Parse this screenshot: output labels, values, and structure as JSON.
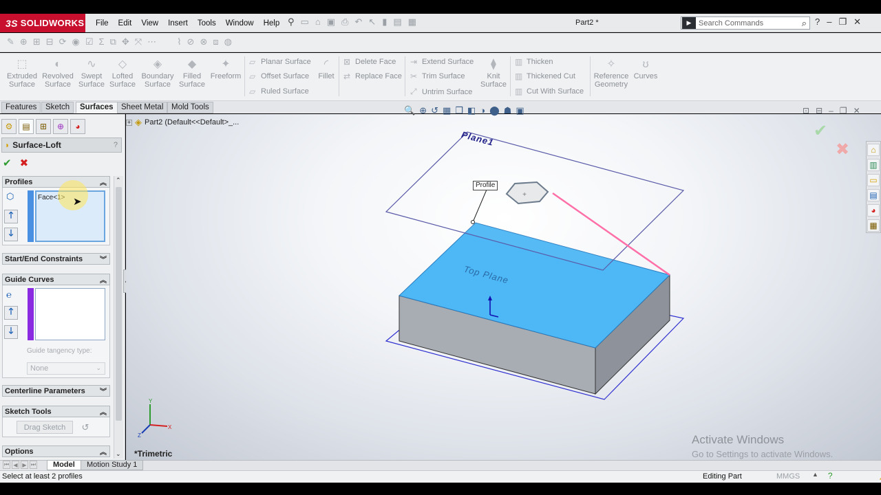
{
  "app": {
    "name": "SOLIDWORKS",
    "logo_prefix": "3S",
    "document_title": "Part2 *"
  },
  "menu": [
    "File",
    "Edit",
    "View",
    "Insert",
    "Tools",
    "Window",
    "Help"
  ],
  "search": {
    "placeholder": "Search Commands"
  },
  "ribbon": {
    "large_buttons": [
      {
        "label": "Extruded Surface",
        "icon": "extruded-surface-icon"
      },
      {
        "label": "Revolved Surface",
        "icon": "revolved-surface-icon"
      },
      {
        "label": "Swept Surface",
        "icon": "swept-surface-icon"
      },
      {
        "label": "Lofted Surface",
        "icon": "lofted-surface-icon"
      },
      {
        "label": "Boundary Surface",
        "icon": "boundary-surface-icon"
      },
      {
        "label": "Filled Surface",
        "icon": "filled-surface-icon"
      },
      {
        "label": "Freeform",
        "icon": "freeform-icon"
      }
    ],
    "group2": [
      "Planar Surface",
      "Offset Surface",
      "Ruled Surface"
    ],
    "fillet": "Fillet",
    "group3": [
      "Delete Face",
      "Replace Face"
    ],
    "group4": [
      "Extend Surface",
      "Trim Surface",
      "Untrim Surface"
    ],
    "knit": "Knit Surface",
    "group5": [
      "Thicken",
      "Thickened Cut",
      "Cut With Surface"
    ],
    "reference_geometry": "Reference Geometry",
    "curves": "Curves"
  },
  "tabs": [
    "Features",
    "Sketch",
    "Surfaces",
    "Sheet Metal",
    "Mold Tools"
  ],
  "active_tab": "Surfaces",
  "property_manager": {
    "title": "Surface-Loft",
    "help": "?",
    "sections": {
      "profiles": {
        "label": "Profiles",
        "items": [
          "Face<1>"
        ]
      },
      "start_end": {
        "label": "Start/End Constraints"
      },
      "guide_curves": {
        "label": "Guide Curves",
        "tangency_label": "Guide tangency type:",
        "tangency_value": "None"
      },
      "centerline": {
        "label": "Centerline Parameters"
      },
      "sketch_tools": {
        "label": "Sketch Tools",
        "drag_sketch": "Drag Sketch"
      },
      "options": {
        "label": "Options"
      }
    }
  },
  "feature_tree": {
    "root": "Part2  (Default<<Default>_..."
  },
  "viewport": {
    "plane1_label": "Plane1",
    "top_plane_label": "Top Plane",
    "callout": "Profile",
    "view_name": "*Trimetric"
  },
  "watermark": {
    "line1": "Activate Windows",
    "line2": "Go to Settings to activate Windows."
  },
  "bottom_tabs": [
    "Model",
    "Motion Study 1"
  ],
  "status": {
    "message": "Select at least 2 profiles",
    "mode": "Editing Part",
    "units": "MMGS",
    "units_arrow": "▲"
  },
  "colors": {
    "brand": "#c8102e",
    "face_blue": "#4db8f5",
    "guide_bar": "#8a2be2",
    "profile_bar": "#4a90e2"
  }
}
